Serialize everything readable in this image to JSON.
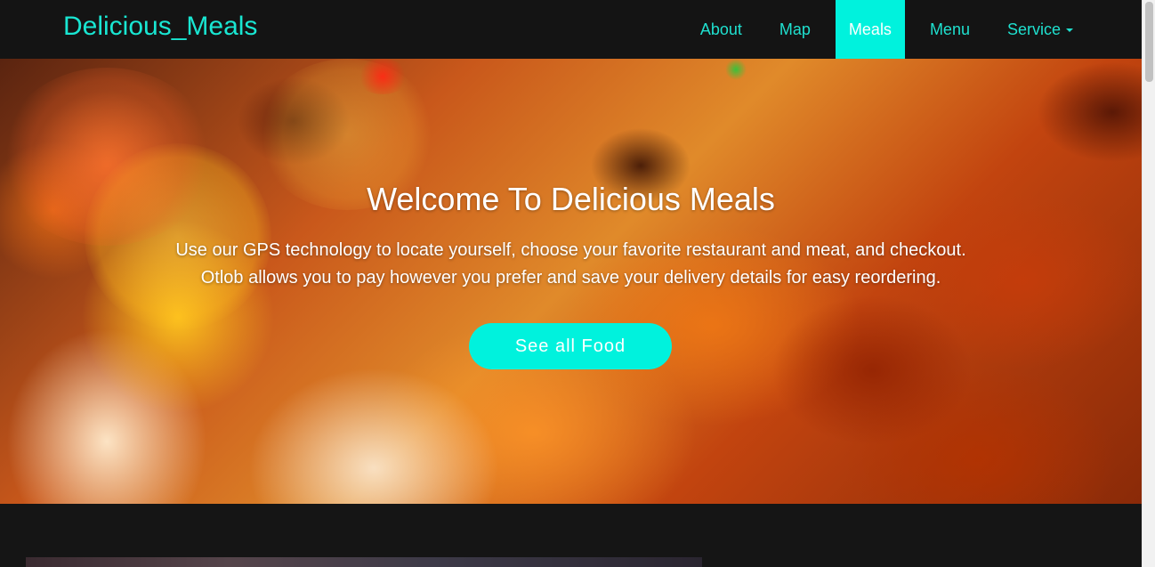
{
  "navbar": {
    "brand": "Delicious_Meals",
    "items": [
      {
        "label": "About",
        "active": false
      },
      {
        "label": "Map",
        "active": false
      },
      {
        "label": "Meals",
        "active": true
      },
      {
        "label": "Menu",
        "active": false
      },
      {
        "label": "Service",
        "active": false,
        "dropdown": true
      }
    ]
  },
  "hero": {
    "title": "Welcome To Delicious Meals",
    "line1": "Use our GPS technology to locate yourself, choose your favorite restaurant and meat, and checkout.",
    "line2": "Otlob allows you to pay however you prefer and save your delivery details for easy reordering.",
    "cta_label": "See all Food"
  },
  "colors": {
    "accent": "#00f2dd",
    "brand_text": "#19e6d2",
    "navbar_bg": "#141414",
    "page_bg": "#151515"
  },
  "icons": {
    "dropdown": "caret-down-icon"
  }
}
